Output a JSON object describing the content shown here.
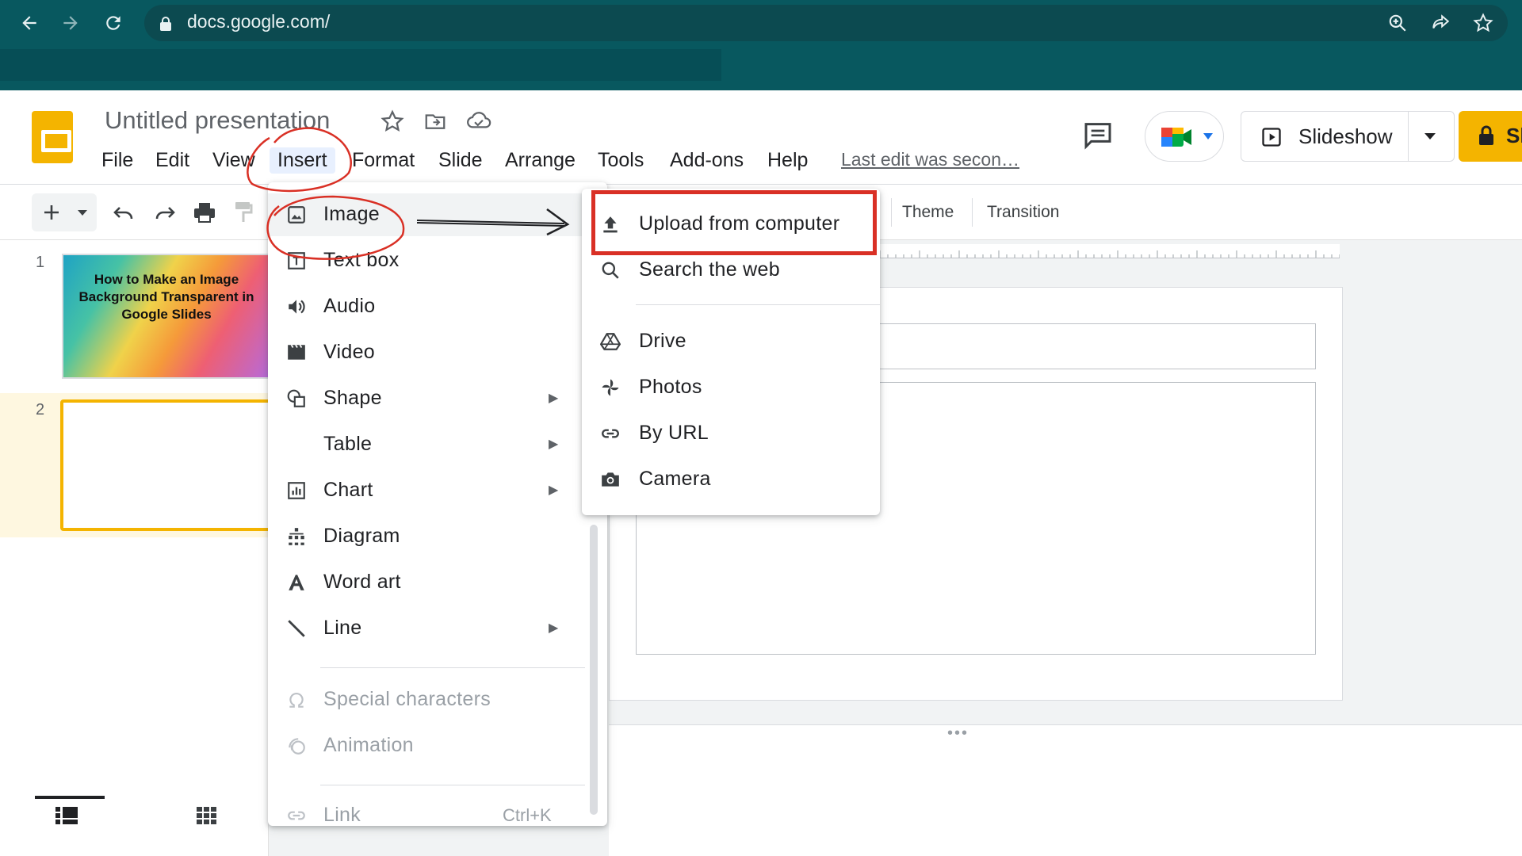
{
  "browser": {
    "url": "docs.google.com/",
    "icons": [
      "back-arrow-icon",
      "forward-arrow-icon",
      "reload-icon",
      "lock-icon",
      "zoom-icon",
      "share-icon",
      "bookmark-star-icon"
    ]
  },
  "header": {
    "doc_title": "Untitled presentation",
    "menus": [
      "File",
      "Edit",
      "View",
      "Insert",
      "Format",
      "Slide",
      "Arrange",
      "Tools",
      "Add-ons",
      "Help"
    ],
    "active_menu": "Insert",
    "last_edit": "Last edit was secon…",
    "slideshow_label": "Slideshow",
    "share_label": "Sh",
    "brand_color": "#f4b400"
  },
  "toolbar": {
    "theme_label": "Theme",
    "transition_label": "Transition"
  },
  "filmstrip": {
    "slides": [
      {
        "number": "1",
        "title": "How to Make an Image Background Transparent in Google Slides"
      },
      {
        "number": "2",
        "title": ""
      }
    ],
    "selected_slide": "2"
  },
  "insert_menu": {
    "items": [
      {
        "label": "Image",
        "icon": "image-icon",
        "submenu": true
      },
      {
        "label": "Text box",
        "icon": "text-box-icon"
      },
      {
        "label": "Audio",
        "icon": "audio-icon"
      },
      {
        "label": "Video",
        "icon": "video-icon"
      },
      {
        "label": "Shape",
        "icon": "shape-icon",
        "submenu": true
      },
      {
        "label": "Table",
        "icon": "",
        "submenu": true
      },
      {
        "label": "Chart",
        "icon": "chart-icon",
        "submenu": true
      },
      {
        "label": "Diagram",
        "icon": "diagram-icon"
      },
      {
        "label": "Word art",
        "icon": "word-art-icon"
      },
      {
        "label": "Line",
        "icon": "line-icon",
        "submenu": true
      },
      {
        "label": "Special characters",
        "icon": "omega-icon",
        "disabled": true
      },
      {
        "label": "Animation",
        "icon": "animation-icon",
        "disabled": true
      },
      {
        "label": "Link",
        "icon": "link-icon",
        "shortcut": "Ctrl+K",
        "disabled": true
      }
    ]
  },
  "image_submenu": {
    "items": [
      {
        "label": "Upload from computer",
        "icon": "upload-icon"
      },
      {
        "label": "Search the web",
        "icon": "search-icon"
      },
      {
        "label": "Drive",
        "icon": "drive-icon"
      },
      {
        "label": "Photos",
        "icon": "photos-icon"
      },
      {
        "label": "By URL",
        "icon": "link-icon"
      },
      {
        "label": "Camera",
        "icon": "camera-icon"
      }
    ]
  },
  "annotations": {
    "highlight_color": "#d93025",
    "highlighted_item": "Upload from computer"
  }
}
